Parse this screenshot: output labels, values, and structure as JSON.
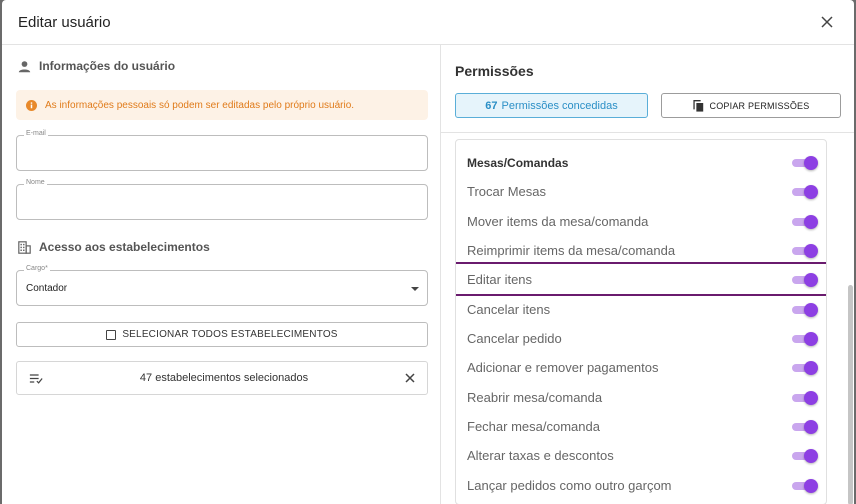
{
  "modal": {
    "title": "Editar usuário"
  },
  "user_info": {
    "heading": "Informações do usuário",
    "alert": "As informações pessoais só podem ser editadas pelo próprio usuário.",
    "email": {
      "label": "E-mail",
      "value": ""
    },
    "name": {
      "label": "Nome",
      "value": ""
    }
  },
  "access": {
    "heading": "Acesso aos estabelecimentos",
    "role": {
      "label": "Cargo*",
      "value": "Contador"
    },
    "select_all_label": "SELECIONAR TODOS ESTABELECIMENTOS",
    "selected_text": "47 estabelecimentos selecionados"
  },
  "permissions": {
    "title": "Permissões",
    "count": "67",
    "count_label": "Permissões concedidas",
    "copy_label": "COPIAR PERMISSÕES",
    "items": [
      {
        "label": "Mesas/Comandas",
        "group": true,
        "enabled": true
      },
      {
        "label": "Trocar Mesas",
        "enabled": true
      },
      {
        "label": "Mover items da mesa/comanda",
        "enabled": true
      },
      {
        "label": "Reimprimir items da mesa/comanda",
        "enabled": true
      },
      {
        "label": "Editar itens",
        "enabled": true,
        "highlighted": true
      },
      {
        "label": "Cancelar itens",
        "enabled": true
      },
      {
        "label": "Cancelar pedido",
        "enabled": true
      },
      {
        "label": "Adicionar e remover pagamentos",
        "enabled": true
      },
      {
        "label": "Reabrir mesa/comanda",
        "enabled": true
      },
      {
        "label": "Fechar mesa/comanda",
        "enabled": true
      },
      {
        "label": "Alterar taxas e descontos",
        "enabled": true
      },
      {
        "label": "Lançar pedidos como outro garçom",
        "enabled": true
      }
    ]
  },
  "colors": {
    "accent": "#8d3fe3",
    "info": "#2b8fc6",
    "warning": "#e07b1a",
    "highlight": "#6a1b6e"
  }
}
